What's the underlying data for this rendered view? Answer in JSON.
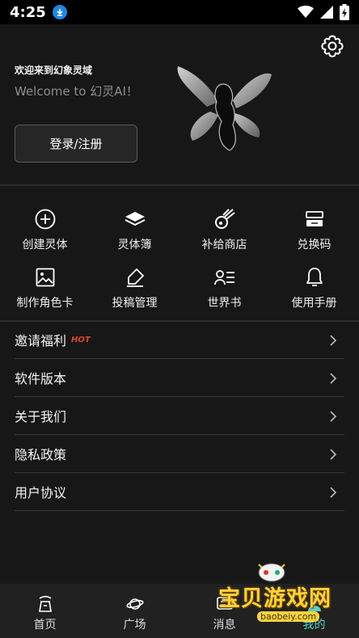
{
  "status_bar": {
    "time": "4:25"
  },
  "header": {
    "welcome_title": "欢迎来到幻象灵域",
    "welcome_subtitle": "Welcome to 幻灵AI！",
    "login_label": "登录/注册"
  },
  "grid": {
    "row1": [
      {
        "label": "创建灵体",
        "icon": "plus-circle-icon"
      },
      {
        "label": "灵体簿",
        "icon": "book-icon"
      },
      {
        "label": "补给商店",
        "icon": "meteor-icon"
      },
      {
        "label": "兑换码",
        "icon": "ticket-icon"
      }
    ],
    "row2": [
      {
        "label": "制作角色卡",
        "icon": "image-icon"
      },
      {
        "label": "投稿管理",
        "icon": "edit-icon"
      },
      {
        "label": "世界书",
        "icon": "person-list-icon"
      },
      {
        "label": "使用手册",
        "icon": "bell-icon"
      }
    ]
  },
  "menu": {
    "items": [
      {
        "label": "邀请福利",
        "tag": "HOT"
      },
      {
        "label": "软件版本"
      },
      {
        "label": "关于我们"
      },
      {
        "label": "隐私政策"
      },
      {
        "label": "用户协议"
      }
    ]
  },
  "tab_bar": {
    "tabs": [
      {
        "label": "首页"
      },
      {
        "label": "广场"
      },
      {
        "label": "消息"
      },
      {
        "label": "我的"
      }
    ],
    "active_color": "#5ad1c4"
  },
  "watermark": {
    "text": "宝贝游戏网",
    "url": "baobeiy.com"
  }
}
